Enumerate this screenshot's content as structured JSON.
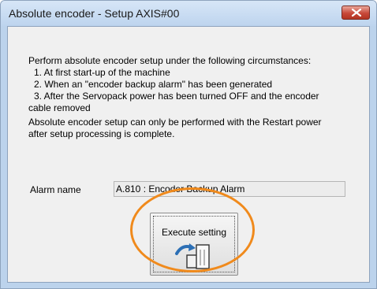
{
  "window": {
    "title": "Absolute encoder - Setup AXIS#00",
    "close_icon": "close-icon"
  },
  "instructions": {
    "intro": "Perform absolute encoder setup under the following circumstances:",
    "item1": "1. At first start-up of the machine",
    "item2": "2. When an \"encoder backup alarm\" has been generated",
    "item3_a": "3. After the Servopack power has been turned OFF and the encoder",
    "item3_b": "cable removed",
    "note_a": "Absolute encoder setup can only be performed with the Restart power",
    "note_b": "after setup processing is complete."
  },
  "alarm": {
    "label": "Alarm name",
    "value": "A.810 : Encoder Backup Alarm"
  },
  "execute_button": {
    "label": "Execute setting",
    "icon": "encoder-setup-icon"
  },
  "colors": {
    "highlight": "#f08a1c",
    "close_button": "#c8493a"
  }
}
